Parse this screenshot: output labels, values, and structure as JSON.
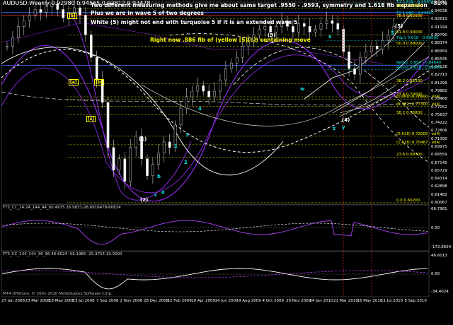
{
  "header": {
    "symbol": "AUDUSD,Weekly",
    "ohlc": "0.92980 0.94565 0.92812 0.93478",
    "corner_number": "82%"
  },
  "annotations": {
    "line1": "Two different measuring methods give me about same target .9550 - .9593, symmetry and 1.618 fib expansion",
    "line2": "Plus we are in wave 5 of two degrees",
    "line3": "White (5) might not end with turquoise 5 if it is an extended wave 5",
    "line4": "Right now .886 fib of (yellow [5][c]) containing move"
  },
  "price_axis": [
    "0.95430",
    "0.94038",
    "0.92615",
    "0.91194",
    "0.89790",
    "0.88374",
    "0.86959",
    "0.85545",
    "0.84128",
    "0.82713",
    "0.81299",
    "0.79882",
    "0.78468",
    "0.77052",
    "0.75637",
    "0.74222",
    "0.72806",
    "0.71390",
    "0.69975",
    "0.68559",
    "0.67145",
    "0.65729",
    "0.64314",
    "0.62898",
    "0.61482",
    "0.60067"
  ],
  "fib_levels": [
    {
      "label": "[5] 0.95990",
      "color": "#ffffff"
    },
    {
      "label": "T1 1.618 - 0.95450",
      "color": "#00e5e5"
    },
    {
      "label": "88.6 0.94680",
      "color": "#ffff00"
    },
    {
      "label": "T2 1.000 - 0.93400",
      "color": "#00e5e5"
    },
    {
      "label": "78.6 0.92900",
      "color": "#ffff00"
    },
    {
      "label": "61.8 0.90000",
      "color": "#ffff00"
    },
    {
      "label": "Tdp1 0.618 - 0.89000",
      "color": "#00e5e5"
    },
    {
      "label": "50.0 0.88000",
      "color": "#ffff00"
    },
    {
      "label": "Refrac 0.854 - 0.84640",
      "color": "#00e5e5"
    },
    {
      "label": "Refrac 0.618 - 0.83800",
      "color": "#00e5e5"
    },
    {
      "label": "38.2 0.81330",
      "color": "#ffff00"
    },
    {
      "label": "23.6 0.79000",
      "color": "#ffff00"
    },
    {
      "label": "(1.000) 0.78600 - w(4)",
      "color": "#ffff00"
    },
    {
      "label": "(0.382) 0.77300 - w(4)",
      "color": "#ffff00"
    },
    {
      "label": "38.2 0.75800",
      "color": "#ffff00"
    },
    {
      "label": "(0.618) 0.72000 - w(4)",
      "color": "#ffff00"
    },
    {
      "label": "(1.618) 0.70487 - w(4)",
      "color": "#ffff00"
    },
    {
      "label": "23.6 0.68300",
      "color": "#ffff00"
    },
    {
      "label": "0.0 0.60200",
      "color": "#ffff00"
    }
  ],
  "wave_labels": [
    {
      "text": "[5]",
      "color": "#ffff00"
    },
    {
      "text": "[a]",
      "color": "#ffff00"
    },
    {
      "text": "[b]",
      "color": "#ffff00"
    },
    {
      "text": "[c]",
      "color": "#ffff00"
    },
    {
      "text": "(1)",
      "color": "#ffffff"
    },
    {
      "text": "(2)",
      "color": "#ffffff"
    },
    {
      "text": "(3)",
      "color": "#ffffff"
    },
    {
      "text": "(4)",
      "color": "#ffffff"
    },
    {
      "text": "(5)",
      "color": "#ffffff"
    },
    {
      "text": "5",
      "color": "#00e5e5"
    },
    {
      "text": "a",
      "color": "#00e5e5"
    },
    {
      "text": "b",
      "color": "#00e5e5"
    },
    {
      "text": "c",
      "color": "#00e5e5"
    },
    {
      "text": "x",
      "color": "#00e5e5"
    },
    {
      "text": "w",
      "color": "#00e5e5"
    },
    {
      "text": "y",
      "color": "#00e5e5"
    },
    {
      "text": "z",
      "color": "#00e5e5"
    },
    {
      "text": "1",
      "color": "#00e5e5"
    },
    {
      "text": "2",
      "color": "#00e5e5"
    },
    {
      "text": "3",
      "color": "#00e5e5"
    },
    {
      "text": "4",
      "color": "#00e5e5"
    }
  ],
  "indicator1": {
    "label": "FT3_CC_24:24_144_44_60.4975  26.9831-26.6916478-60824",
    "axis": [
      "66.7981",
      "0.00",
      "-172.6654"
    ]
  },
  "indicator2": {
    "label": "FT3_CC_144_144_36_36-46.6024 -59.1985 -25.3754 10.0000",
    "axis": [
      "46.6013",
      "0.00",
      "-34.4024"
    ]
  },
  "time_axis": [
    "27 Jan 2008",
    "23 Mar 2008",
    "18 May 2008",
    "13 Jul 2008",
    "7 Sep 2008",
    "2 Nov 2008",
    "28 Dec 2008",
    "22 Feb 2009",
    "19 Apr 2009",
    "14 Jun 2009",
    "9 Aug 2009",
    "4 Oct 2009",
    "29 Nov 2009",
    "24 Jan 2010",
    "21 Mar 2010",
    "16 May 2010",
    "11 Jul 2010",
    "5 Sep 2010"
  ],
  "copyright": "MT4 Offshore, © 2001-2010 MetaQuotes Software Corp.",
  "colors": {
    "background": "#000000",
    "fib": "#ffff00",
    "target": "#00e5e5",
    "cycle": "#8a2be2",
    "wave_curve": "#ffffff",
    "annotation": "#ffffff"
  }
}
